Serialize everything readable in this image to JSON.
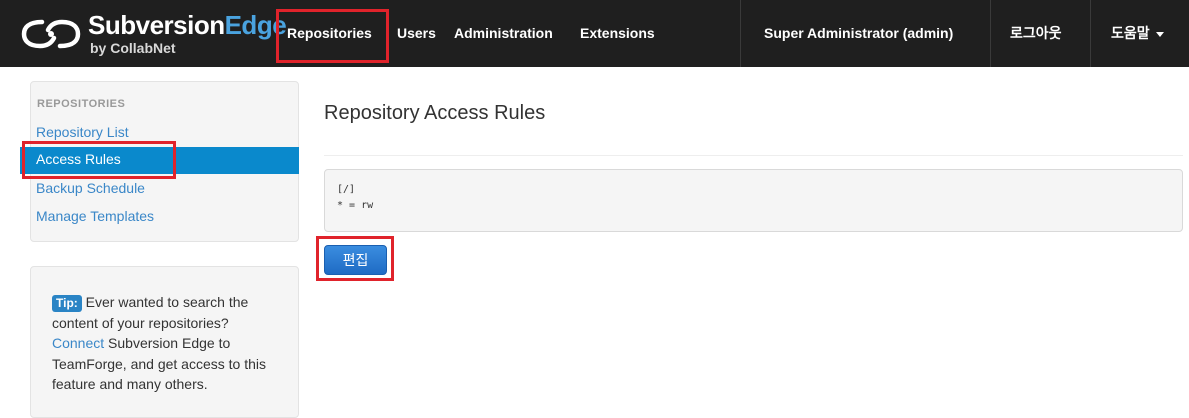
{
  "brand": {
    "name_main": "Subversion",
    "name_accent": "Edge",
    "subtitle": "by CollabNet",
    "logo_icon": "collabnet-logo-icon"
  },
  "nav": {
    "items": [
      "Repositories",
      "Users",
      "Administration",
      "Extensions"
    ],
    "active": "Repositories",
    "user": "Super Administrator (admin)",
    "logout": "로그아웃",
    "help": "도움말"
  },
  "sidebar": {
    "header": "REPOSITORIES",
    "items": [
      "Repository List",
      "Access Rules",
      "Backup Schedule",
      "Manage Templates"
    ],
    "active": "Access Rules"
  },
  "tip": {
    "badge": "Tip:",
    "text_1": "Ever wanted to search the content of your repositories?",
    "link": "Connect",
    "text_2": "Subversion Edge to TeamForge, and get access to this feature and many others."
  },
  "main": {
    "title": "Repository Access Rules",
    "rules_text": "[/]\n* = rw",
    "edit_button": "편집"
  },
  "colors": {
    "navbar_bg": "#1f1f1f",
    "accent_blue": "#0a89cc",
    "link_blue": "#3a87c8",
    "highlight_red": "#e0232b"
  }
}
